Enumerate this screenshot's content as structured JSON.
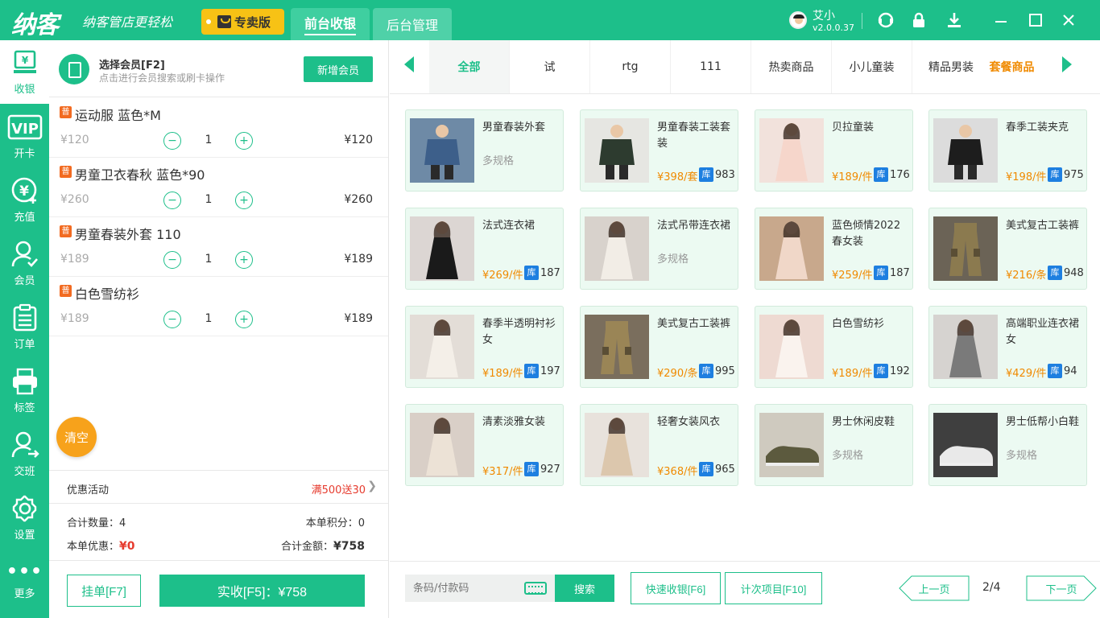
{
  "topbar": {
    "logo": "纳客",
    "slogan": "纳客管店更轻松",
    "edition": "专卖版",
    "tabs": [
      "前台收银",
      "后台管理"
    ],
    "user_name": "艾小",
    "version": "v2.0.0.37"
  },
  "sidebar": [
    {
      "label": "收银",
      "icon": "cashier-icon"
    },
    {
      "label": "开卡",
      "icon": "vip-card-icon"
    },
    {
      "label": "充值",
      "icon": "recharge-icon"
    },
    {
      "label": "会员",
      "icon": "member-icon"
    },
    {
      "label": "订单",
      "icon": "order-icon"
    },
    {
      "label": "标签",
      "icon": "printer-icon"
    },
    {
      "label": "交班",
      "icon": "shift-handover-icon"
    },
    {
      "label": "设置",
      "icon": "settings-icon"
    },
    {
      "label": "更多",
      "icon": "more-icon"
    }
  ],
  "member": {
    "title": "选择会员[F2]",
    "subtitle": "点击进行会员搜索或刷卡操作",
    "add_button": "新增会员"
  },
  "cart": {
    "items": [
      {
        "tag": "普",
        "name": "运动服 蓝色*M",
        "price": "¥120",
        "qty": "1",
        "subtotal": "¥120"
      },
      {
        "tag": "普",
        "name": "男童卫衣春秋 蓝色*90",
        "price": "¥260",
        "qty": "1",
        "subtotal": "¥260"
      },
      {
        "tag": "普",
        "name": "男童春装外套 110",
        "price": "¥189",
        "qty": "1",
        "subtotal": "¥189"
      },
      {
        "tag": "普",
        "name": "白色雪纺衫",
        "price": "¥189",
        "qty": "1",
        "subtotal": "¥189"
      }
    ],
    "clear_button": "清空",
    "promo_label": "优惠活动",
    "promo_value": "满500送30",
    "total_qty_label": "合计数量：",
    "total_qty": "4",
    "points_label": "本单积分：",
    "points": "0",
    "discount_label": "本单优惠：",
    "discount": "¥0",
    "total_label": "合计金额：",
    "total": "¥758",
    "hang_button": "挂单[F7]",
    "pay_button": "实收[F5]：¥758"
  },
  "categories": [
    "全部",
    "试",
    "rtg",
    "111",
    "热卖商品",
    "小儿童装",
    "精品男装",
    "套餐商品"
  ],
  "products": [
    {
      "name": "男童春装外套",
      "multi": "多规格",
      "price": "",
      "stock_badge": "",
      "stock": "",
      "img": "kids-jacket"
    },
    {
      "name": "男童春装工装套装",
      "multi": "",
      "price": "¥398/套",
      "stock_badge": "库",
      "stock": "983",
      "img": "kids-suit"
    },
    {
      "name": "贝拉童装",
      "multi": "",
      "price": "¥189/件",
      "stock_badge": "库",
      "stock": "176",
      "img": "girl-dress"
    },
    {
      "name": "春季工装夹克",
      "multi": "",
      "price": "¥198/件",
      "stock_badge": "库",
      "stock": "975",
      "img": "work-jacket"
    },
    {
      "name": "法式连衣裙",
      "multi": "",
      "price": "¥269/件",
      "stock_badge": "库",
      "stock": "187",
      "img": "black-dress"
    },
    {
      "name": "法式吊带连衣裙",
      "multi": "多规格",
      "price": "",
      "stock_badge": "",
      "stock": "",
      "img": "white-dress"
    },
    {
      "name": "蓝色倾情2022春女装",
      "multi": "",
      "price": "¥259/件",
      "stock_badge": "库",
      "stock": "187",
      "img": "tulle-dress"
    },
    {
      "name": "美式复古工装裤",
      "multi": "",
      "price": "¥216/条",
      "stock_badge": "库",
      "stock": "948",
      "img": "cargo-pants"
    },
    {
      "name": "春季半透明衬衫女",
      "multi": "",
      "price": "¥189/件",
      "stock_badge": "库",
      "stock": "197",
      "img": "sheer-shirt"
    },
    {
      "name": "美式复古工装裤",
      "multi": "",
      "price": "¥290/条",
      "stock_badge": "库",
      "stock": "995",
      "img": "cargo-pants-2"
    },
    {
      "name": "白色雪纺衫",
      "multi": "",
      "price": "¥189/件",
      "stock_badge": "库",
      "stock": "192",
      "img": "chiffon-blouse"
    },
    {
      "name": "高端职业连衣裙女",
      "multi": "",
      "price": "¥429/件",
      "stock_badge": "库",
      "stock": "94",
      "img": "office-dress"
    },
    {
      "name": "清素淡雅女装",
      "multi": "",
      "price": "¥317/件",
      "stock_badge": "库",
      "stock": "927",
      "img": "knit-dress"
    },
    {
      "name": "轻奢女装风衣",
      "multi": "",
      "price": "¥368/件",
      "stock_badge": "库",
      "stock": "965",
      "img": "trench-coat"
    },
    {
      "name": "男士休闲皮鞋",
      "multi": "多规格",
      "price": "",
      "stock_badge": "",
      "stock": "",
      "img": "casual-shoes"
    },
    {
      "name": "男士低帮小白鞋",
      "multi": "多规格",
      "price": "",
      "stock_badge": "",
      "stock": "",
      "img": "white-sneakers"
    }
  ],
  "bottom": {
    "scan_placeholder": "条码/付款码",
    "search_button": "搜索",
    "quick_button": "快速收银[F6]",
    "count_button": "计次项目[F10]",
    "prev_button": "上一页",
    "page": "2/4",
    "next_button": "下一页"
  },
  "colors": {
    "brand": "#1dbf8a",
    "price": "#f08a00",
    "stock_badge": "#1e7fe0",
    "tag": "#f26b21",
    "promo": "#e63b2e"
  }
}
